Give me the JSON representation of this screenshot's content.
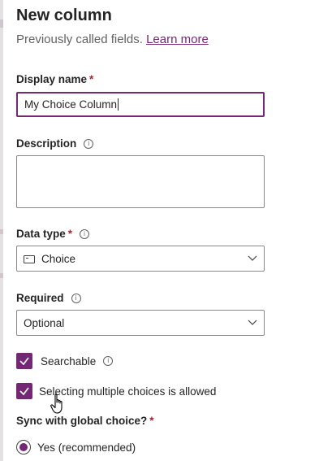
{
  "panel": {
    "title": "New column",
    "subtitle": "Previously called fields.",
    "learn_more": "Learn more"
  },
  "fields": {
    "display_name": {
      "label": "Display name",
      "required_mark": "*",
      "value": "My Choice Column"
    },
    "description": {
      "label": "Description",
      "value": ""
    },
    "data_type": {
      "label": "Data type",
      "required_mark": "*",
      "value": "Choice"
    },
    "required": {
      "label": "Required",
      "value": "Optional"
    }
  },
  "checkboxes": {
    "searchable": {
      "label": "Searchable",
      "checked": true
    },
    "multiple_choices": {
      "label": "Selecting multiple choices is allowed",
      "checked": true
    }
  },
  "sync": {
    "label": "Sync with global choice?",
    "required_mark": "*",
    "option_yes": "Yes (recommended)"
  },
  "icons": {
    "info": "info-icon",
    "chevron": "chevron-down-icon",
    "check": "checkmark-icon",
    "choice": "choice-icon",
    "cursor": "hand-pointer-icon"
  },
  "colors": {
    "accent": "#742774",
    "required": "#a4262c",
    "border": "#8a8886"
  }
}
